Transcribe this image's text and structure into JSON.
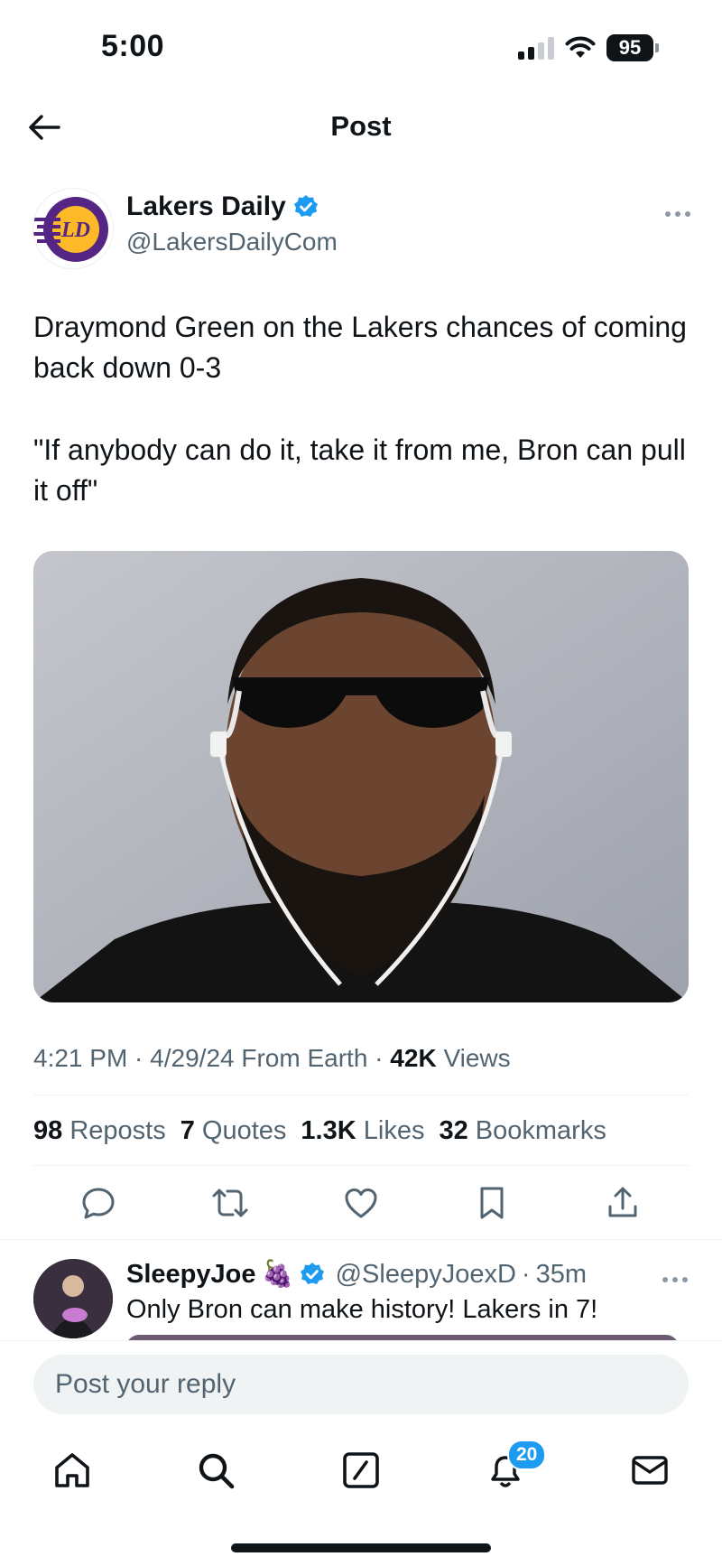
{
  "status_bar": {
    "time": "5:00",
    "battery": "95"
  },
  "header": {
    "title": "Post"
  },
  "post": {
    "author_name": "Lakers Daily",
    "author_handle": "@LakersDailyCom",
    "text_line1": "Draymond Green on the Lakers chances of coming back down 0-3",
    "text_line2": "\"If anybody can do it, take it from me, Bron can pull it off\"",
    "time": "4:21 PM",
    "date": "4/29/24",
    "source": "From Earth",
    "views_count": "42K",
    "views_label": "Views"
  },
  "stats": {
    "reposts_count": "98",
    "reposts_label": "Reposts",
    "quotes_count": "7",
    "quotes_label": "Quotes",
    "likes_count": "1.3K",
    "likes_label": "Likes",
    "bookmarks_count": "32",
    "bookmarks_label": "Bookmarks"
  },
  "reply": {
    "name": "SleepyJoe",
    "emoji": "🍇",
    "handle": "@SleepyJoexD",
    "age": "35m",
    "text": "Only Bron can make history! Lakers in 7!"
  },
  "compose": {
    "placeholder": "Post your reply"
  },
  "tabbar": {
    "notifications_badge": "20"
  },
  "colors": {
    "accent": "#1d9bf0",
    "text": "#0f1419",
    "muted": "#536471"
  },
  "icons": [
    "back-arrow-icon",
    "verified-badge-icon",
    "more-icon",
    "reply-icon",
    "repost-icon",
    "like-icon",
    "bookmark-icon",
    "share-icon",
    "home-icon",
    "search-icon",
    "compose-icon",
    "notifications-icon",
    "messages-icon"
  ]
}
